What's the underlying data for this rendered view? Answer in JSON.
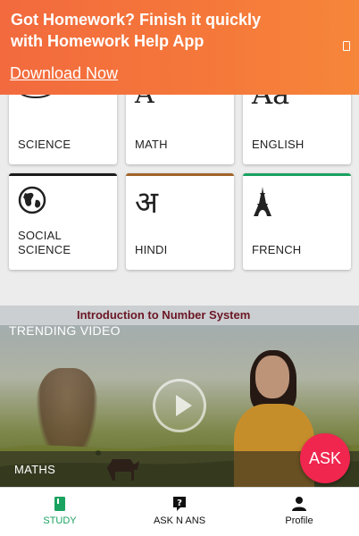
{
  "banner": {
    "line1": "Got Homework? Finish it quickly",
    "line2": "with Homework Help App",
    "link": "Download Now",
    "close_icon": "close-icon"
  },
  "subjects": [
    {
      "label": "SCIENCE",
      "icon": "atom-icon",
      "color": "#ffffff"
    },
    {
      "label": "MATH",
      "icon": "math-icon",
      "glyph": "A",
      "color": "#ffffff"
    },
    {
      "label": "ENGLISH",
      "icon": "english-icon",
      "glyph": "Aa",
      "color": "#ffffff"
    },
    {
      "label_line1": "SOCIAL",
      "label_line2": "SCIENCE",
      "icon": "globe-icon",
      "color": "#1a1a1a"
    },
    {
      "label": "HINDI",
      "icon": "hindi-icon",
      "glyph": "अ",
      "color": "#a0642a"
    },
    {
      "label": "FRENCH",
      "icon": "eiffel-tower-icon",
      "color": "#1aa260"
    }
  ],
  "video": {
    "title": "Introduction to Number System",
    "section": "TRENDING VIDEO",
    "subject": "MATHS"
  },
  "fab": {
    "label": "ASK",
    "color": "#f0264f"
  },
  "nav": {
    "items": [
      {
        "label": "STUDY",
        "icon": "book-icon",
        "active": true
      },
      {
        "label": "ASK N ANS",
        "icon": "question-icon",
        "active": false
      },
      {
        "label": "Profile",
        "icon": "person-icon",
        "active": false
      }
    ],
    "active_color": "#1aa260"
  }
}
